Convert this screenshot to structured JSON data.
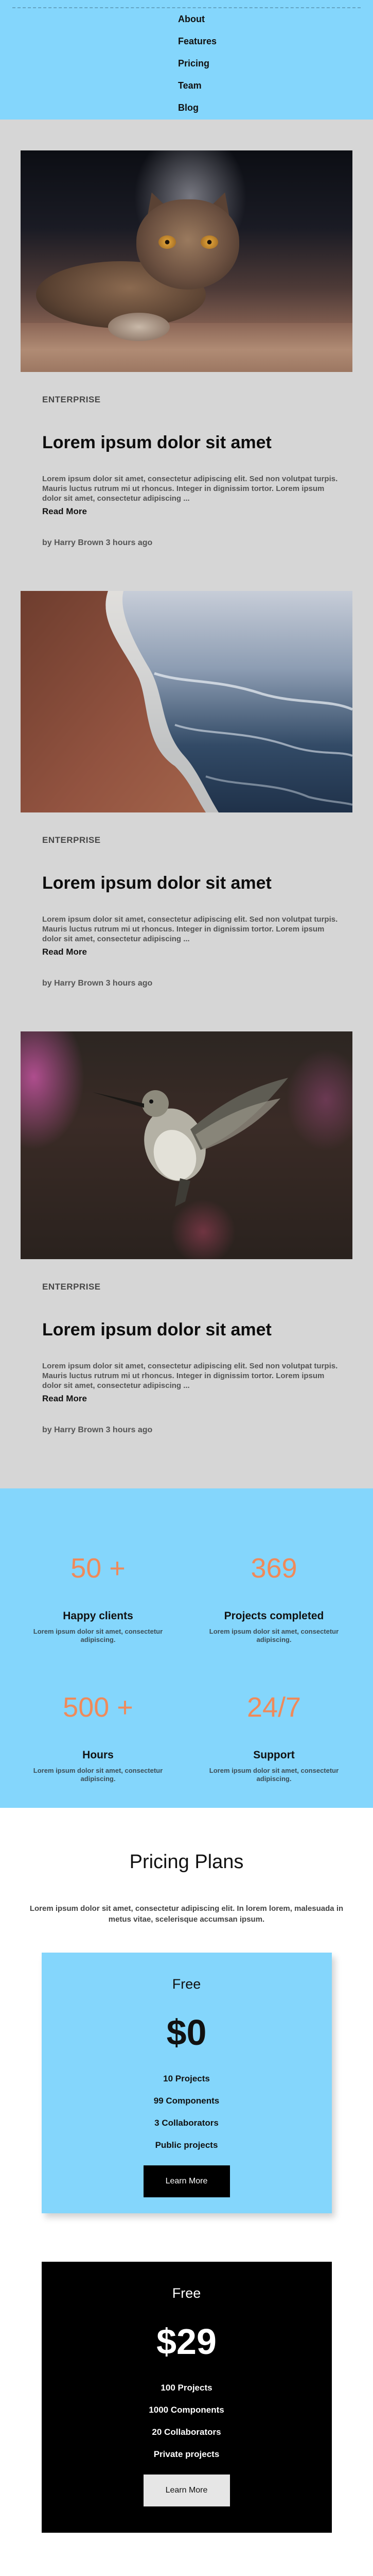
{
  "nav": {
    "items": [
      "About",
      "Features",
      "Pricing",
      "Team",
      "Blog"
    ]
  },
  "posts": [
    {
      "image": "cat-image",
      "category": "ENTERPRISE",
      "title": "Lorem ipsum dolor sit amet",
      "excerpt": "Lorem ipsum dolor sit amet, consectetur adipiscing elit. Sed non volutpat turpis. Mauris luctus rutrum mi ut rhoncus. Integer in dignissim tortor. Lorem ipsum dolor sit amet, consectetur adipiscing ...",
      "read_more": "Read More",
      "byline": "by Harry Brown 3 hours ago"
    },
    {
      "image": "beach-image",
      "category": "ENTERPRISE",
      "title": "Lorem ipsum dolor sit amet",
      "excerpt": "Lorem ipsum dolor sit amet, consectetur adipiscing elit. Sed non volutpat turpis. Mauris luctus rutrum mi ut rhoncus. Integer in dignissim tortor. Lorem ipsum dolor sit amet, consectetur adipiscing ...",
      "read_more": "Read More",
      "byline": "by Harry Brown 3 hours ago"
    },
    {
      "image": "hummingbird-image",
      "category": "ENTERPRISE",
      "title": "Lorem ipsum dolor sit amet",
      "excerpt": "Lorem ipsum dolor sit amet, consectetur adipiscing elit. Sed non volutpat turpis. Mauris luctus rutrum mi ut rhoncus. Integer in dignissim tortor. Lorem ipsum dolor sit amet, consectetur adipiscing ...",
      "read_more": "Read More",
      "byline": "by Harry Brown 3 hours ago"
    }
  ],
  "stats": [
    {
      "value": "50 +",
      "label": "Happy clients",
      "desc": "Lorem ipsum dolor sit amet, consectetur adipiscing."
    },
    {
      "value": "369",
      "label": "Projects completed",
      "desc": "Lorem ipsum dolor sit amet, consectetur adipiscing."
    },
    {
      "value": "500 +",
      "label": "Hours",
      "desc": "Lorem ipsum dolor sit amet, consectetur adipiscing."
    },
    {
      "value": "24/7",
      "label": "Support",
      "desc": "Lorem ipsum dolor sit amet, consectetur adipiscing."
    }
  ],
  "pricing": {
    "title": "Pricing Plans",
    "subtitle": "Lorem ipsum dolor sit amet, consectetur adipiscing elit. In lorem lorem, malesuada in metus vitae, scelerisque accumsan ipsum.",
    "plans": [
      {
        "name": "Free",
        "price": "$0",
        "features": [
          "10 Projects",
          "99 Components",
          "3 Collaborators",
          "Public projects"
        ],
        "button": "Learn More"
      },
      {
        "name": "Free",
        "price": "$29",
        "features": [
          "100 Projects",
          "1000 Components",
          "20 Collaborators",
          "Private projects"
        ],
        "button": "Learn More"
      }
    ]
  },
  "colors": {
    "accent_blue": "#84d6fc",
    "stat_orange": "#ef8a5a",
    "blog_bg": "#d6d6d6"
  }
}
